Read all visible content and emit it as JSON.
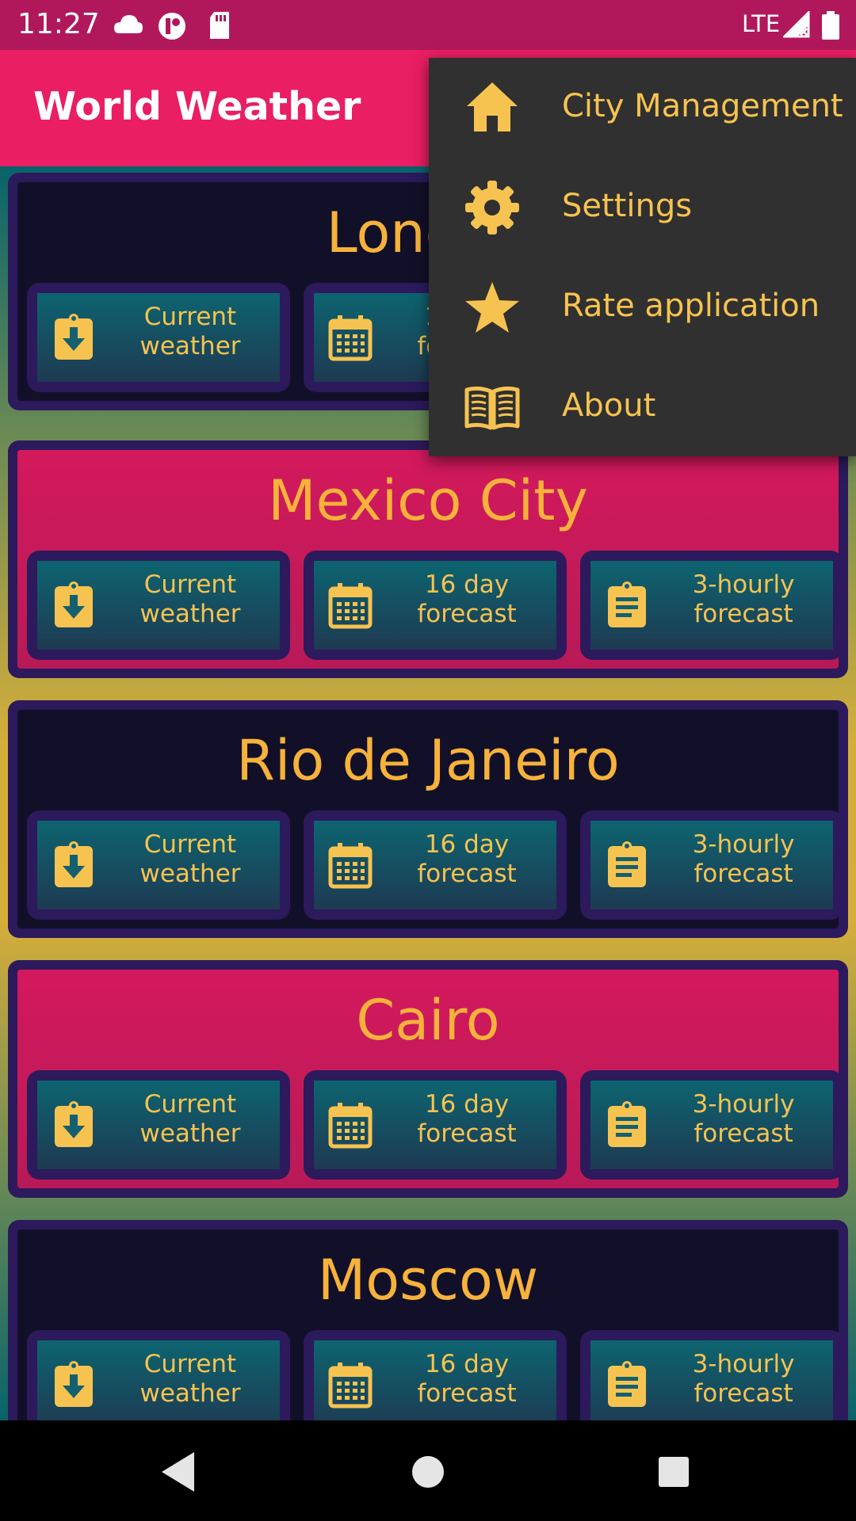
{
  "status_bar": {
    "time": "11:27",
    "network": "LTE",
    "icons": [
      "cloud-icon",
      "app-icon",
      "sd-card-icon",
      "signal-icon",
      "battery-icon"
    ]
  },
  "app_bar": {
    "title": "World Weather"
  },
  "menu": {
    "items": [
      {
        "label": "City Management",
        "icon": "home-icon"
      },
      {
        "label": "Settings",
        "icon": "gear-icon"
      },
      {
        "label": "Rate application",
        "icon": "star-icon"
      },
      {
        "label": "About",
        "icon": "book-icon"
      }
    ]
  },
  "buttons": {
    "current_1": "Current",
    "current_2": "weather",
    "forecast16_1": "16 day",
    "forecast16_2": "forecast",
    "hourly_1": "3-hourly",
    "hourly_2": "forecast"
  },
  "cities": [
    {
      "name": "London"
    },
    {
      "name": "Mexico City"
    },
    {
      "name": "Rio de Janeiro"
    },
    {
      "name": "Cairo"
    },
    {
      "name": "Moscow"
    }
  ],
  "colors": {
    "status_bar": "#b1185c",
    "app_bar": "#e91e63",
    "accent": "#f6b23b",
    "menu_bg": "#303030",
    "button_border": "#2c1a5c"
  }
}
